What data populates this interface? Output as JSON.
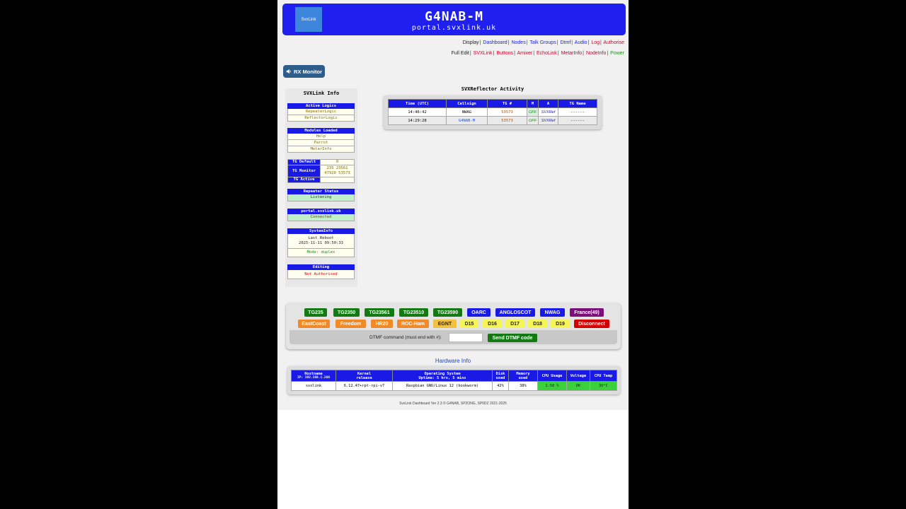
{
  "header": {
    "logo_text": "SvxLink",
    "title": "G4NAB-M",
    "subtitle": "portal.svxlink.uk"
  },
  "nav1": {
    "prefix": "Display",
    "links": [
      "Dashboard",
      "Nodes",
      "Talk Groups",
      "Dtmf",
      "Audio",
      "Log",
      "Authorise"
    ]
  },
  "nav2": {
    "prefix": "Full Edit",
    "links": [
      "SVXLink",
      "Buttons",
      "Amixer",
      "EchoLink",
      "MetarInfo",
      "NodeInfo",
      "Power"
    ]
  },
  "rx_monitor": {
    "label": "RX Monitor"
  },
  "svxlink_info": {
    "title": "SVXLink Info",
    "active_logics": {
      "header": "Active Logics",
      "items": [
        "RepeaterLogic",
        "ReflectorLogic"
      ]
    },
    "modules_loaded": {
      "header": "Modules Loaded",
      "items": [
        "Help",
        "Parrot",
        "MetarInfo"
      ]
    },
    "tg": {
      "default_label": "TG Default",
      "default_value": "0",
      "monitor_label": "TG Monitor",
      "monitor_value_1": "235 23561",
      "monitor_value_2": "47920 53573",
      "active_label": "TG Active",
      "active_value": ""
    },
    "repeater_status": {
      "header": "Repeater Status",
      "value": "Listening"
    },
    "portal": {
      "header": "portal.svxlink.uk",
      "value": "Connected"
    },
    "system_info": {
      "header": "SystemInfo",
      "reboot_label": "Last Reboot",
      "reboot_time": "2025-11-11 09:50:33",
      "mode": "Mode: duplex"
    },
    "editing": {
      "header": "Editing",
      "value": "Not Authorised"
    }
  },
  "reflector": {
    "title": "SVXReflector Activity",
    "columns": [
      "Time (UTC)",
      "Callsign",
      "TG #",
      "M",
      "A",
      "TG Name"
    ],
    "rows": [
      {
        "time": "14:46:42",
        "callsign": "NWAG",
        "tg": "53573",
        "m": "OFF",
        "a": "SVXRef",
        "tg_name": "------"
      },
      {
        "time": "14:29:28",
        "callsign": "G4NAB-M",
        "tg": "53573",
        "m": "OFF",
        "a": "SVXRef",
        "tg_name": "------"
      }
    ]
  },
  "tg_buttons": {
    "row1": [
      "TG235",
      "TG2350",
      "TG23561",
      "TG23510",
      "TG23590",
      "OARC",
      "ANGLOSCOT",
      "NWAG",
      "France(49)"
    ],
    "row2": [
      "EastCoast",
      "Freedom",
      "HR20",
      "ROC-Ham",
      "EGNT",
      "D15",
      "D16",
      "D17",
      "D18",
      "D19",
      "Disconnect"
    ],
    "colors": {
      "green": "#137a13",
      "blue": "#1a1ae6",
      "purple": "#7a0f7a",
      "orange": "#f08a28",
      "yellow": "#f5f55a",
      "red": "#d40000"
    }
  },
  "dtmf": {
    "label": "DTMF command (must end with #):",
    "value": "",
    "button": "Send DTMF code"
  },
  "hardware": {
    "title": "Hardware Info",
    "headers": [
      {
        "l1": "Hostname",
        "l2": "IP: 192.168.1.206"
      },
      {
        "l1": "Kernel",
        "l2": "release"
      },
      {
        "l1": "Operating System",
        "l2": "Uptime: 5 hrs, 5 mins"
      },
      {
        "l1": "Disk",
        "l2": "used"
      },
      {
        "l1": "Memory",
        "l2": "used"
      },
      {
        "l1": "CPU Usage",
        "l2": ""
      },
      {
        "l1": "Voltage",
        "l2": ""
      },
      {
        "l1": "CPU Temp",
        "l2": ""
      }
    ],
    "values": {
      "hostname": "svxlink",
      "kernel": "6.12.47+rpt-rpi-v7",
      "os": "Raspbian GNU/Linux 12 (bookworm)",
      "disk": "42%",
      "memory": "38%",
      "cpu": "1.58 %",
      "voltage": "OK",
      "temp": "36°C"
    }
  },
  "footer": "SvxLink Dashboard Ver 2.3 © G4NAB, SP2ONG, SP0DZ 2021-2025"
}
